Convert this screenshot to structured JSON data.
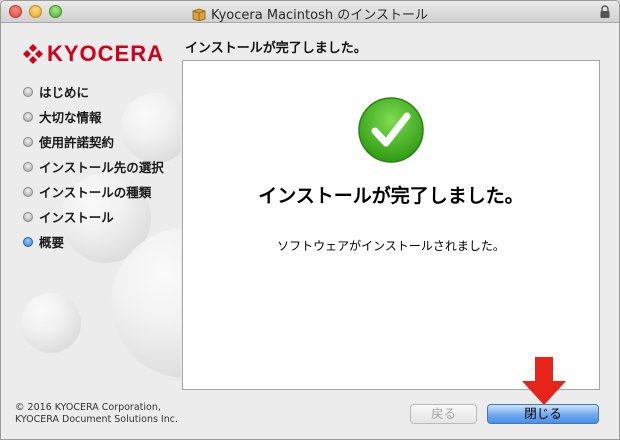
{
  "window": {
    "title": "Kyocera Macintosh のインストール"
  },
  "sidebar": {
    "logo_text": "KYOCERA",
    "steps": [
      {
        "label": "はじめに",
        "active": false
      },
      {
        "label": "大切な情報",
        "active": false
      },
      {
        "label": "使用許諾契約",
        "active": false
      },
      {
        "label": "インストール先の選択",
        "active": false
      },
      {
        "label": "インストールの種類",
        "active": false
      },
      {
        "label": "インストール",
        "active": false
      },
      {
        "label": "概要",
        "active": true
      }
    ],
    "copyright_line1": "© 2016 KYOCERA Corporation,",
    "copyright_line2": "KYOCERA Document Solutions Inc."
  },
  "main": {
    "heading": "インストールが完了しました。",
    "big_message": "インストールが完了しました。",
    "sub_message": "ソフトウェアがインストールされました。"
  },
  "buttons": {
    "back_label": "戻る",
    "back_enabled": false,
    "close_label": "閉じる"
  },
  "colors": {
    "brand_red": "#d4001a",
    "success_green": "#3aa81c",
    "accent_blue": "#4a8fe8",
    "annotation_red": "#e8231a"
  },
  "icons": {
    "window_icon": "package-icon",
    "lock": "lock-icon",
    "success": "checkmark-circle-icon",
    "annotation": "red-down-arrow-icon"
  }
}
